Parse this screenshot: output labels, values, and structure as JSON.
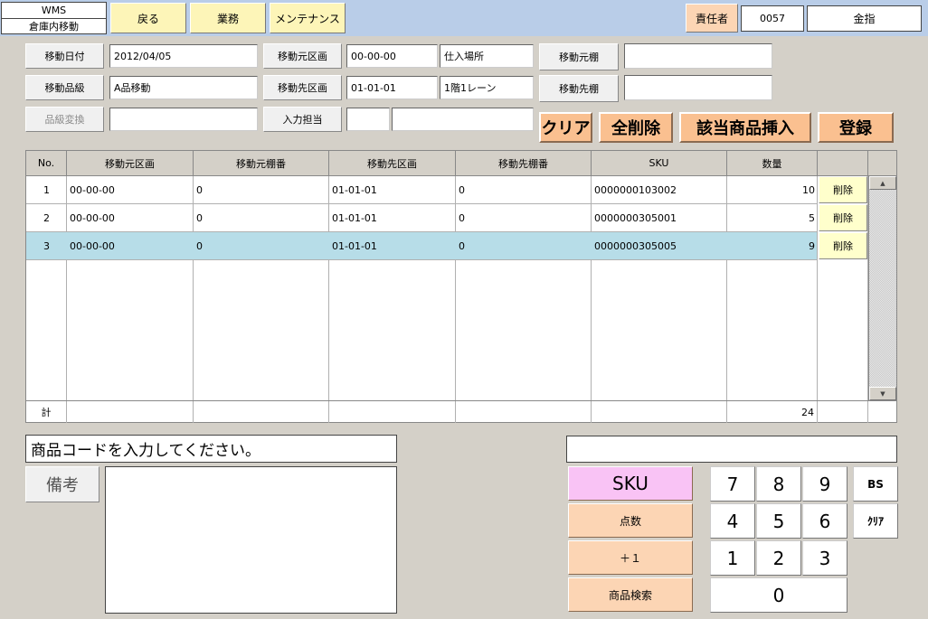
{
  "header": {
    "app_name": "WMS",
    "screen_name": "倉庫内移動",
    "back_label": "戻る",
    "business_label": "業務",
    "maintenance_label": "メンテナンス",
    "manager_label": "責任者",
    "manager_code": "0057",
    "manager_name": "金指"
  },
  "form": {
    "move_date_label": "移動日付",
    "move_date": "2012/04/05",
    "grade_label": "移動品級",
    "grade": "A品移動",
    "grade_convert_label": "品級変換",
    "grade_convert": "",
    "src_area_label": "移動元区画",
    "src_area_code": "00-00-00",
    "src_area_name": "仕入場所",
    "dst_area_label": "移動先区画",
    "dst_area_code": "01-01-01",
    "dst_area_name": "1階1レーン",
    "input_person_label": "入力担当",
    "input_person_code": "",
    "input_person_name": "",
    "src_shelf_label": "移動元棚",
    "src_shelf": "",
    "dst_shelf_label": "移動先棚",
    "dst_shelf": ""
  },
  "actions": {
    "clear": "クリア",
    "delete_all": "全削除",
    "insert_items": "該当商品挿入",
    "register": "登録"
  },
  "table": {
    "headers": [
      "No.",
      "移動元区画",
      "移動元棚番",
      "移動先区画",
      "移動先棚番",
      "SKU",
      "数量"
    ],
    "delete_label": "削除",
    "rows": [
      {
        "no": "1",
        "src_area": "00-00-00",
        "src_shelf": "0",
        "dst_area": "01-01-01",
        "dst_shelf": "0",
        "sku": "0000000103002",
        "qty": "10"
      },
      {
        "no": "2",
        "src_area": "00-00-00",
        "src_shelf": "0",
        "dst_area": "01-01-01",
        "dst_shelf": "0",
        "sku": "0000000305001",
        "qty": "5"
      },
      {
        "no": "3",
        "src_area": "00-00-00",
        "src_shelf": "0",
        "dst_area": "01-01-01",
        "dst_shelf": "0",
        "sku": "0000000305005",
        "qty": "9"
      }
    ],
    "total_label": "計",
    "total_qty": "24"
  },
  "bottom": {
    "message": "商品コードを入力してください。",
    "remarks_label": "備考",
    "remarks": "",
    "scan_value": ""
  },
  "modes": {
    "sku": "SKU",
    "points": "点数",
    "plus_one": "＋１",
    "product_search": "商品検索"
  },
  "keypad": {
    "k7": "7",
    "k8": "8",
    "k9": "9",
    "k4": "4",
    "k5": "5",
    "k6": "6",
    "k1": "1",
    "k2": "2",
    "k3": "3",
    "k0": "0",
    "bs": "BS",
    "clear": "ｸﾘｱ"
  },
  "colors": {
    "topbar": "#b9cde8",
    "top_button": "#fdf5b8",
    "action_button": "#fac090",
    "selected_row": "#b7dde8",
    "sku_mode": "#f9c3f5"
  }
}
